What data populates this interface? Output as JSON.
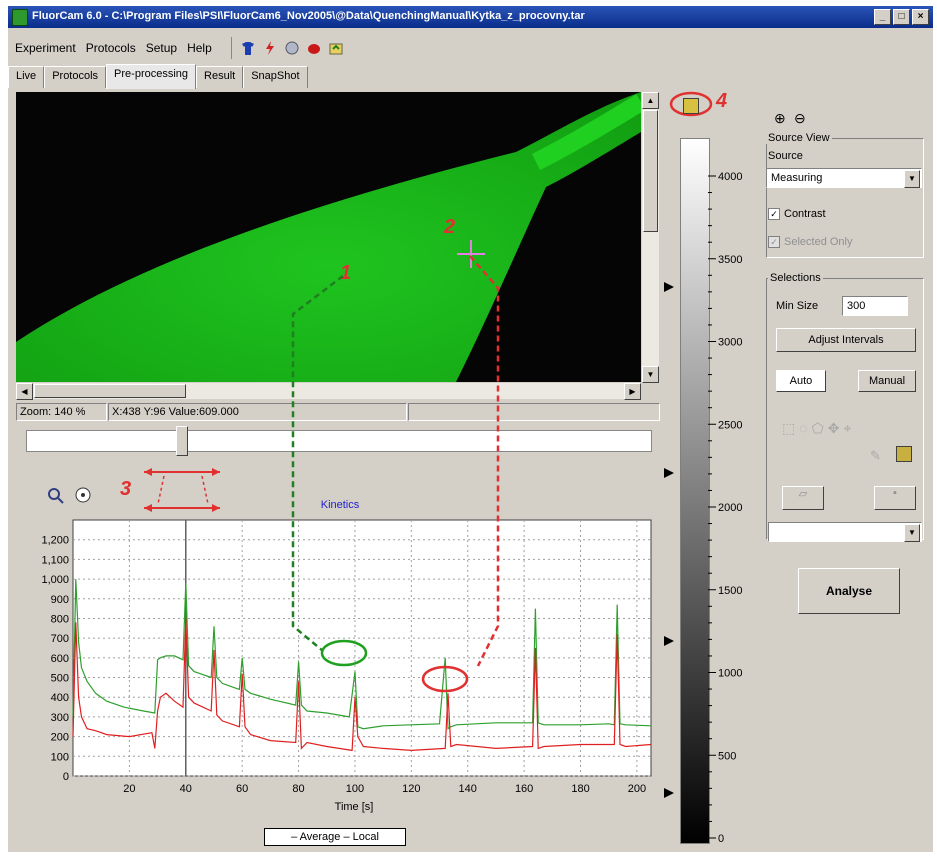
{
  "window": {
    "title": "FluorCam 6.0 - C:\\Program Files\\PSI\\FluorCam6_Nov2005\\@Data\\QuenchingManual\\Kytka_z_procovny.tar",
    "controls": [
      "_",
      "□",
      "×"
    ]
  },
  "menu": [
    "Experiment",
    "Protocols",
    "Setup",
    "Help"
  ],
  "tabs": [
    "Live",
    "Protocols",
    "Pre-processing",
    "Result",
    "SnapShot"
  ],
  "active_tab": "Pre-processing",
  "status": {
    "zoom": "Zoom: 140 %",
    "coords": "X:438 Y:96 Value:609.000"
  },
  "annotations": {
    "n1": "1",
    "n2": "2",
    "n3": "3",
    "n4": "4"
  },
  "colorbar": {
    "ticks": [
      "4000",
      "3500",
      "3000",
      "2500",
      "2000",
      "1500",
      "1000",
      "500",
      "0"
    ],
    "top_label": "4000"
  },
  "right_panel": {
    "source_view_title": "Source View",
    "source_label": "Source",
    "source_value": "Measuring",
    "contrast_label": "Contrast",
    "selected_only_label": "Selected Only",
    "selections_title": "Selections",
    "min_size_label": "Min Size",
    "min_size_value": "300",
    "adjust_intervals_label": "Adjust Intervals",
    "auto_label": "Auto",
    "manual_label": "Manual",
    "analyse_label": "Analyse"
  },
  "chart_data": {
    "type": "line",
    "title": "Kinetics",
    "xlabel": "Time [s]",
    "ylabel": "",
    "xlim": [
      0,
      205
    ],
    "ylim": [
      0,
      1300
    ],
    "x_ticks": [
      20,
      40,
      60,
      80,
      100,
      120,
      140,
      160,
      180,
      200
    ],
    "y_ticks": [
      0,
      100,
      200,
      300,
      400,
      500,
      600,
      700,
      800,
      900,
      1000,
      1100,
      1200
    ],
    "y_tick_labels": [
      "0",
      "100",
      "200",
      "300",
      "400",
      "500",
      "600",
      "700",
      "800",
      "900",
      "1,000",
      "1,100",
      "1,200"
    ],
    "legend_text": "– Average – Local",
    "series": [
      {
        "name": "Average",
        "color": "#2ea02e",
        "x": [
          0,
          1,
          2,
          3,
          5,
          8,
          12,
          18,
          25,
          29,
          30,
          31,
          33,
          36,
          39,
          40,
          41,
          43,
          45,
          49,
          50,
          51,
          53,
          57,
          59,
          60,
          61,
          63,
          70,
          79,
          80,
          81,
          83,
          90,
          98,
          100,
          101,
          103,
          110,
          120,
          130,
          132,
          133,
          134,
          136,
          150,
          163,
          164,
          165,
          167,
          180,
          190,
          192,
          193,
          194,
          196,
          205
        ],
        "y": [
          300,
          1000,
          680,
          550,
          480,
          420,
          380,
          350,
          330,
          320,
          590,
          600,
          610,
          610,
          590,
          980,
          560,
          530,
          520,
          500,
          760,
          500,
          470,
          450,
          440,
          600,
          440,
          420,
          390,
          360,
          580,
          360,
          330,
          320,
          300,
          530,
          250,
          240,
          255,
          260,
          265,
          600,
          240,
          250,
          260,
          270,
          270,
          850,
          270,
          260,
          260,
          265,
          260,
          870,
          265,
          260,
          255
        ]
      },
      {
        "name": "Local",
        "color": "#e02020",
        "x": [
          0,
          1,
          2,
          3,
          5,
          8,
          12,
          20,
          28,
          29,
          30,
          31,
          33,
          36,
          39,
          40,
          41,
          43,
          49,
          50,
          51,
          53,
          59,
          60,
          61,
          63,
          70,
          79,
          80,
          81,
          83,
          90,
          99,
          100,
          101,
          103,
          110,
          120,
          132,
          133,
          134,
          136,
          150,
          163,
          164,
          165,
          167,
          180,
          192,
          193,
          194,
          196,
          205
        ],
        "y": [
          200,
          780,
          400,
          300,
          240,
          230,
          210,
          200,
          220,
          140,
          330,
          400,
          420,
          380,
          350,
          800,
          400,
          370,
          330,
          640,
          310,
          280,
          250,
          520,
          250,
          210,
          180,
          170,
          480,
          140,
          170,
          150,
          130,
          400,
          200,
          150,
          140,
          130,
          140,
          420,
          150,
          160,
          140,
          150,
          650,
          140,
          150,
          160,
          160,
          720,
          160,
          150,
          160
        ]
      }
    ]
  }
}
